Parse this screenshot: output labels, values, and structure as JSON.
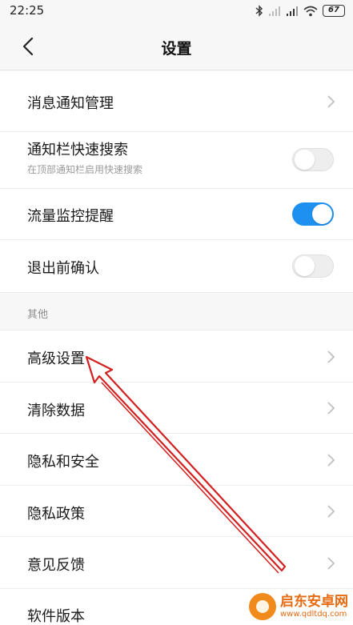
{
  "status_bar": {
    "time": "22:25",
    "battery": "67",
    "icons": [
      "bluetooth-icon",
      "signal-icon",
      "signal-icon",
      "wifi-icon",
      "battery-icon"
    ]
  },
  "header": {
    "title": "设置",
    "back_icon": "chevron-left-icon"
  },
  "settings": {
    "notify_manage": {
      "label": "消息通知管理"
    },
    "quick_search": {
      "label": "通知栏快速搜索",
      "sub": "在顶部通知栏启用快速搜索",
      "enabled": false
    },
    "traffic_alert": {
      "label": "流量监控提醒",
      "enabled": true
    },
    "exit_confirm": {
      "label": "退出前确认",
      "enabled": false
    }
  },
  "other_section": {
    "title": "其他",
    "items": [
      {
        "label": "高级设置"
      },
      {
        "label": "清除数据"
      },
      {
        "label": "隐私和安全"
      },
      {
        "label": "隐私政策"
      },
      {
        "label": "意见反馈"
      },
      {
        "label": "软件版本"
      }
    ]
  },
  "watermark": {
    "name": "启东安卓网",
    "url": "www.qdltdq.com"
  },
  "colors": {
    "toggle_on": "#1e90f0",
    "arrow": "#d42020",
    "background": "#f7f7f7"
  }
}
